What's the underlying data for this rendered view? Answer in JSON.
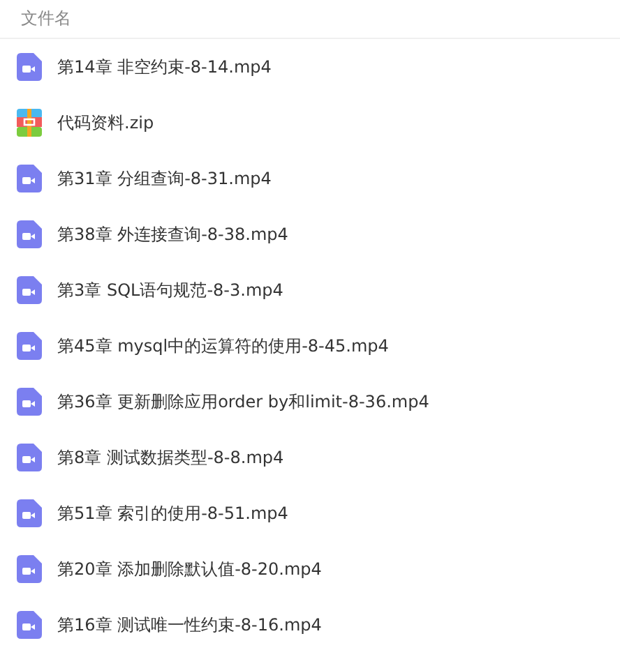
{
  "header": {
    "column": "文件名"
  },
  "files": [
    {
      "name": "第14章 非空约束-8-14.mp4",
      "kind": "video"
    },
    {
      "name": "代码资料.zip",
      "kind": "zip"
    },
    {
      "name": "第31章 分组查询-8-31.mp4",
      "kind": "video"
    },
    {
      "name": "第38章 外连接查询-8-38.mp4",
      "kind": "video"
    },
    {
      "name": "第3章 SQL语句规范-8-3.mp4",
      "kind": "video"
    },
    {
      "name": "第45章 mysql中的运算符的使用-8-45.mp4",
      "kind": "video"
    },
    {
      "name": "第36章 更新删除应用order by和limit-8-36.mp4",
      "kind": "video"
    },
    {
      "name": "第8章 测试数据类型-8-8.mp4",
      "kind": "video"
    },
    {
      "name": "第51章 索引的使用-8-51.mp4",
      "kind": "video"
    },
    {
      "name": "第20章 添加删除默认值-8-20.mp4",
      "kind": "video"
    },
    {
      "name": "第16章 测试唯一性约束-8-16.mp4",
      "kind": "video"
    }
  ]
}
